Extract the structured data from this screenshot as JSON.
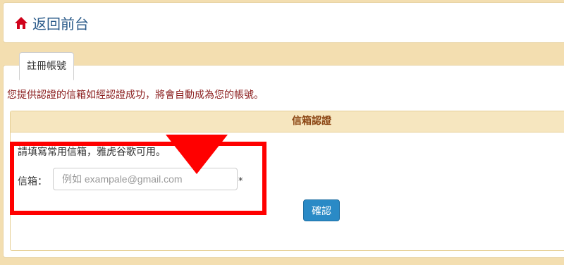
{
  "header": {
    "home_icon": "home-icon",
    "back_label": "返回前台"
  },
  "tab": {
    "label": "註冊帳號"
  },
  "notice": "您提供認證的信箱如經認證成功，將會自動成為您的帳號。",
  "verify": {
    "header": "信箱認證",
    "hint": "請填寫常用信箱，雅虎谷歌可用。",
    "email_label": "信箱：",
    "email_value": "",
    "email_placeholder": "例如 exampale@gmail.com",
    "required_mark": "*",
    "confirm_label": "確認"
  },
  "colors": {
    "background": "#f3deb0",
    "header_link": "#2b5b8a",
    "home_icon": "#d0021b",
    "notice_text": "#8b1e1e",
    "section_header_bg": "#f6e6bf",
    "section_header_text": "#8b4513",
    "button": "#2a8ac6",
    "annotation": "#ff0000"
  }
}
